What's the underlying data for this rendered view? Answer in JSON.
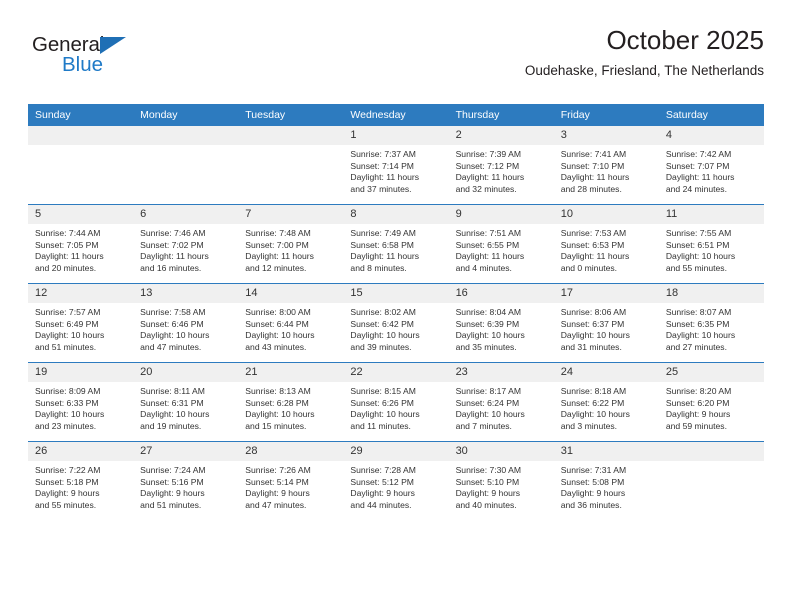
{
  "brand": {
    "name_top": "General",
    "name_bottom": "Blue",
    "accent_color": "#1f7ac7",
    "triangle_color": "#1f6fb5"
  },
  "header": {
    "title": "October 2025",
    "subtitle": "Oudehaske, Friesland, The Netherlands"
  },
  "theme": {
    "header_row_bg": "#2d7bbf",
    "header_row_text": "#ffffff",
    "daynum_bg": "#f0f0f0",
    "body_text": "#333333",
    "page_bg": "#ffffff"
  },
  "weekdays": [
    "Sunday",
    "Monday",
    "Tuesday",
    "Wednesday",
    "Thursday",
    "Friday",
    "Saturday"
  ],
  "labels": {
    "sunrise": "Sunrise:",
    "sunset": "Sunset:",
    "daylight": "Daylight:"
  },
  "weeks": [
    [
      {
        "blank": true,
        "day": ""
      },
      {
        "blank": true,
        "day": ""
      },
      {
        "blank": true,
        "day": ""
      },
      {
        "blank": false,
        "day": "1",
        "sunrise": "Sunrise: 7:37 AM",
        "sunset": "Sunset: 7:14 PM",
        "daylight_1": "Daylight: 11 hours",
        "daylight_2": "and 37 minutes."
      },
      {
        "blank": false,
        "day": "2",
        "sunrise": "Sunrise: 7:39 AM",
        "sunset": "Sunset: 7:12 PM",
        "daylight_1": "Daylight: 11 hours",
        "daylight_2": "and 32 minutes."
      },
      {
        "blank": false,
        "day": "3",
        "sunrise": "Sunrise: 7:41 AM",
        "sunset": "Sunset: 7:10 PM",
        "daylight_1": "Daylight: 11 hours",
        "daylight_2": "and 28 minutes."
      },
      {
        "blank": false,
        "day": "4",
        "sunrise": "Sunrise: 7:42 AM",
        "sunset": "Sunset: 7:07 PM",
        "daylight_1": "Daylight: 11 hours",
        "daylight_2": "and 24 minutes."
      }
    ],
    [
      {
        "blank": false,
        "day": "5",
        "sunrise": "Sunrise: 7:44 AM",
        "sunset": "Sunset: 7:05 PM",
        "daylight_1": "Daylight: 11 hours",
        "daylight_2": "and 20 minutes."
      },
      {
        "blank": false,
        "day": "6",
        "sunrise": "Sunrise: 7:46 AM",
        "sunset": "Sunset: 7:02 PM",
        "daylight_1": "Daylight: 11 hours",
        "daylight_2": "and 16 minutes."
      },
      {
        "blank": false,
        "day": "7",
        "sunrise": "Sunrise: 7:48 AM",
        "sunset": "Sunset: 7:00 PM",
        "daylight_1": "Daylight: 11 hours",
        "daylight_2": "and 12 minutes."
      },
      {
        "blank": false,
        "day": "8",
        "sunrise": "Sunrise: 7:49 AM",
        "sunset": "Sunset: 6:58 PM",
        "daylight_1": "Daylight: 11 hours",
        "daylight_2": "and 8 minutes."
      },
      {
        "blank": false,
        "day": "9",
        "sunrise": "Sunrise: 7:51 AM",
        "sunset": "Sunset: 6:55 PM",
        "daylight_1": "Daylight: 11 hours",
        "daylight_2": "and 4 minutes."
      },
      {
        "blank": false,
        "day": "10",
        "sunrise": "Sunrise: 7:53 AM",
        "sunset": "Sunset: 6:53 PM",
        "daylight_1": "Daylight: 11 hours",
        "daylight_2": "and 0 minutes."
      },
      {
        "blank": false,
        "day": "11",
        "sunrise": "Sunrise: 7:55 AM",
        "sunset": "Sunset: 6:51 PM",
        "daylight_1": "Daylight: 10 hours",
        "daylight_2": "and 55 minutes."
      }
    ],
    [
      {
        "blank": false,
        "day": "12",
        "sunrise": "Sunrise: 7:57 AM",
        "sunset": "Sunset: 6:49 PM",
        "daylight_1": "Daylight: 10 hours",
        "daylight_2": "and 51 minutes."
      },
      {
        "blank": false,
        "day": "13",
        "sunrise": "Sunrise: 7:58 AM",
        "sunset": "Sunset: 6:46 PM",
        "daylight_1": "Daylight: 10 hours",
        "daylight_2": "and 47 minutes."
      },
      {
        "blank": false,
        "day": "14",
        "sunrise": "Sunrise: 8:00 AM",
        "sunset": "Sunset: 6:44 PM",
        "daylight_1": "Daylight: 10 hours",
        "daylight_2": "and 43 minutes."
      },
      {
        "blank": false,
        "day": "15",
        "sunrise": "Sunrise: 8:02 AM",
        "sunset": "Sunset: 6:42 PM",
        "daylight_1": "Daylight: 10 hours",
        "daylight_2": "and 39 minutes."
      },
      {
        "blank": false,
        "day": "16",
        "sunrise": "Sunrise: 8:04 AM",
        "sunset": "Sunset: 6:39 PM",
        "daylight_1": "Daylight: 10 hours",
        "daylight_2": "and 35 minutes."
      },
      {
        "blank": false,
        "day": "17",
        "sunrise": "Sunrise: 8:06 AM",
        "sunset": "Sunset: 6:37 PM",
        "daylight_1": "Daylight: 10 hours",
        "daylight_2": "and 31 minutes."
      },
      {
        "blank": false,
        "day": "18",
        "sunrise": "Sunrise: 8:07 AM",
        "sunset": "Sunset: 6:35 PM",
        "daylight_1": "Daylight: 10 hours",
        "daylight_2": "and 27 minutes."
      }
    ],
    [
      {
        "blank": false,
        "day": "19",
        "sunrise": "Sunrise: 8:09 AM",
        "sunset": "Sunset: 6:33 PM",
        "daylight_1": "Daylight: 10 hours",
        "daylight_2": "and 23 minutes."
      },
      {
        "blank": false,
        "day": "20",
        "sunrise": "Sunrise: 8:11 AM",
        "sunset": "Sunset: 6:31 PM",
        "daylight_1": "Daylight: 10 hours",
        "daylight_2": "and 19 minutes."
      },
      {
        "blank": false,
        "day": "21",
        "sunrise": "Sunrise: 8:13 AM",
        "sunset": "Sunset: 6:28 PM",
        "daylight_1": "Daylight: 10 hours",
        "daylight_2": "and 15 minutes."
      },
      {
        "blank": false,
        "day": "22",
        "sunrise": "Sunrise: 8:15 AM",
        "sunset": "Sunset: 6:26 PM",
        "daylight_1": "Daylight: 10 hours",
        "daylight_2": "and 11 minutes."
      },
      {
        "blank": false,
        "day": "23",
        "sunrise": "Sunrise: 8:17 AM",
        "sunset": "Sunset: 6:24 PM",
        "daylight_1": "Daylight: 10 hours",
        "daylight_2": "and 7 minutes."
      },
      {
        "blank": false,
        "day": "24",
        "sunrise": "Sunrise: 8:18 AM",
        "sunset": "Sunset: 6:22 PM",
        "daylight_1": "Daylight: 10 hours",
        "daylight_2": "and 3 minutes."
      },
      {
        "blank": false,
        "day": "25",
        "sunrise": "Sunrise: 8:20 AM",
        "sunset": "Sunset: 6:20 PM",
        "daylight_1": "Daylight: 9 hours",
        "daylight_2": "and 59 minutes."
      }
    ],
    [
      {
        "blank": false,
        "day": "26",
        "sunrise": "Sunrise: 7:22 AM",
        "sunset": "Sunset: 5:18 PM",
        "daylight_1": "Daylight: 9 hours",
        "daylight_2": "and 55 minutes."
      },
      {
        "blank": false,
        "day": "27",
        "sunrise": "Sunrise: 7:24 AM",
        "sunset": "Sunset: 5:16 PM",
        "daylight_1": "Daylight: 9 hours",
        "daylight_2": "and 51 minutes."
      },
      {
        "blank": false,
        "day": "28",
        "sunrise": "Sunrise: 7:26 AM",
        "sunset": "Sunset: 5:14 PM",
        "daylight_1": "Daylight: 9 hours",
        "daylight_2": "and 47 minutes."
      },
      {
        "blank": false,
        "day": "29",
        "sunrise": "Sunrise: 7:28 AM",
        "sunset": "Sunset: 5:12 PM",
        "daylight_1": "Daylight: 9 hours",
        "daylight_2": "and 44 minutes."
      },
      {
        "blank": false,
        "day": "30",
        "sunrise": "Sunrise: 7:30 AM",
        "sunset": "Sunset: 5:10 PM",
        "daylight_1": "Daylight: 9 hours",
        "daylight_2": "and 40 minutes."
      },
      {
        "blank": false,
        "day": "31",
        "sunrise": "Sunrise: 7:31 AM",
        "sunset": "Sunset: 5:08 PM",
        "daylight_1": "Daylight: 9 hours",
        "daylight_2": "and 36 minutes."
      },
      {
        "blank": true,
        "day": ""
      }
    ]
  ]
}
